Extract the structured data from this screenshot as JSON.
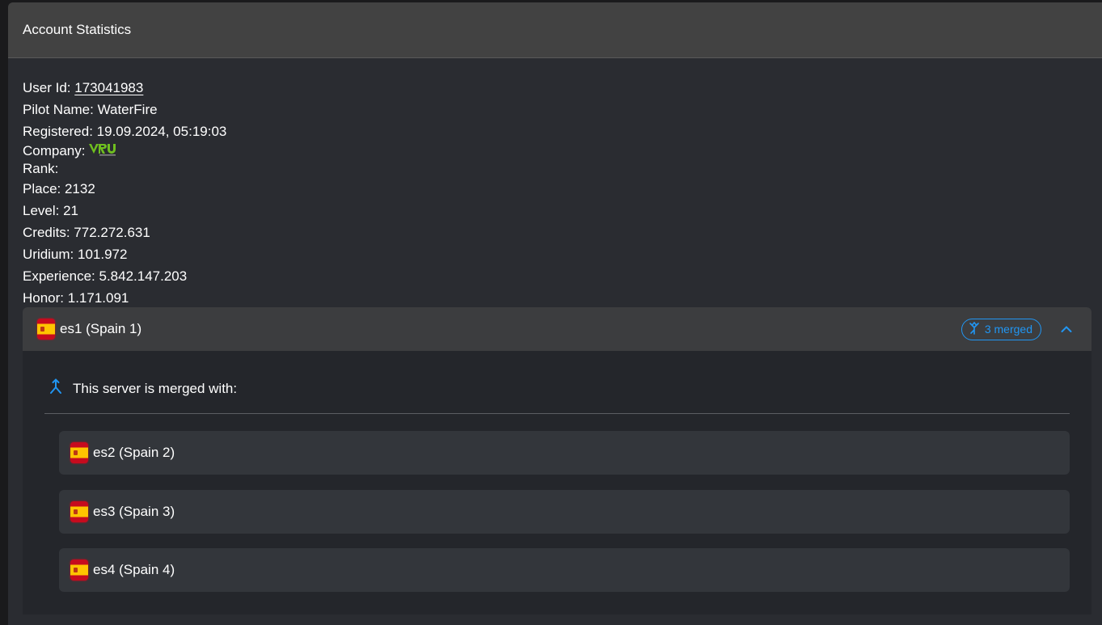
{
  "header": {
    "title": "Account Statistics"
  },
  "stats": {
    "user_id_label": "User Id: ",
    "user_id": "173041983",
    "pilot_name": "Pilot Name: WaterFire",
    "registered": "Registered: 19.09.2024, 05:19:03",
    "company_label": "Company:",
    "rank_label": "Rank:",
    "place": "Place: 2132",
    "level": "Level: 21",
    "credits": "Credits: 772.272.631",
    "uridium": "Uridium: 101.972",
    "experience": "Experience: 5.842.147.203",
    "honor": "Honor: 1.171.091"
  },
  "server": {
    "name": "es1 (Spain 1)",
    "merged_badge": "3 merged",
    "merge_title": "This server is merged with:",
    "merged_servers": [
      {
        "name": "es2 (Spain 2)"
      },
      {
        "name": "es3 (Spain 3)"
      },
      {
        "name": "es4 (Spain 4)"
      }
    ]
  },
  "colors": {
    "accent": "#2196f3",
    "header_bg": "#424242",
    "card_bg": "#2a2c31",
    "company_logo": "#6fbf1f"
  },
  "icons": {
    "flag": "spain-flag-icon",
    "merge": "merge-icon",
    "collapse": "chevron-up-icon",
    "company": "company-logo-vru"
  }
}
